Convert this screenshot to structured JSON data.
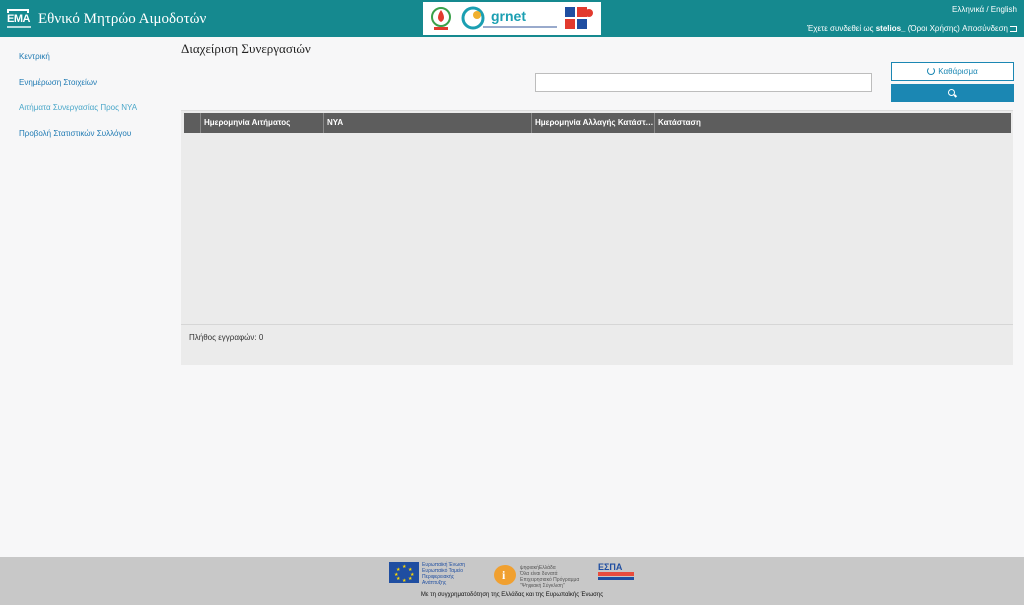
{
  "header": {
    "logo_text": "ΕΜΑ",
    "title": "Εθνικό Μητρώο Αιμοδοτών",
    "partner_grnet": "grnet",
    "language": "Ελληνικά / English",
    "user_prefix": "Έχετε συνδεθεί ως",
    "username": "stelios_",
    "terms": "(Όροι Χρήσης)",
    "logout": "Αποσύνδεση"
  },
  "sidebar": {
    "items": [
      {
        "label": "Κεντρική"
      },
      {
        "label": "Ενημέρωση Στοιχείων"
      },
      {
        "label": "Αιτήματα Συνεργασίας Προς ΝΥΑ"
      },
      {
        "label": "Προβολή Στατιστικών Συλλόγου"
      }
    ]
  },
  "main": {
    "page_title": "Διαχείριση Συνεργασιών",
    "search_value": "",
    "clear_label": "Καθάρισμα",
    "table": {
      "columns": [
        "",
        "Ημερομηνία Αιτήματος",
        "ΝΥΑ",
        "Ημερομηνία Αλλαγής Κατάστασης",
        "Κατάσταση"
      ],
      "rows": []
    },
    "record_count": "Πλήθος εγγραφών: 0"
  },
  "footer": {
    "eu_text": [
      "Ευρωπαϊκή Ένωση",
      "Ευρωπαϊκό Ταμείο",
      "Περιφερειακής",
      "Ανάπτυξης"
    ],
    "dg_text": [
      "ψηφιακήΕλλάδα",
      "Όλα είναι δυνατά",
      "Επιχειρησιακό Πρόγραμμα",
      "\"Ψηφιακή Σύγκλιση\""
    ],
    "espa": "ΕΣΠΑ",
    "cofunding": "Με τη συγχρηματοδότηση της Ελλάδας και της Ευρωπαϊκής Ένωσης"
  },
  "colors": {
    "header_bg": "#15898f",
    "link": "#1f7ab3",
    "active_link": "#4aa7c9",
    "primary_button": "#1b87b3",
    "table_header": "#5d5d5d"
  }
}
